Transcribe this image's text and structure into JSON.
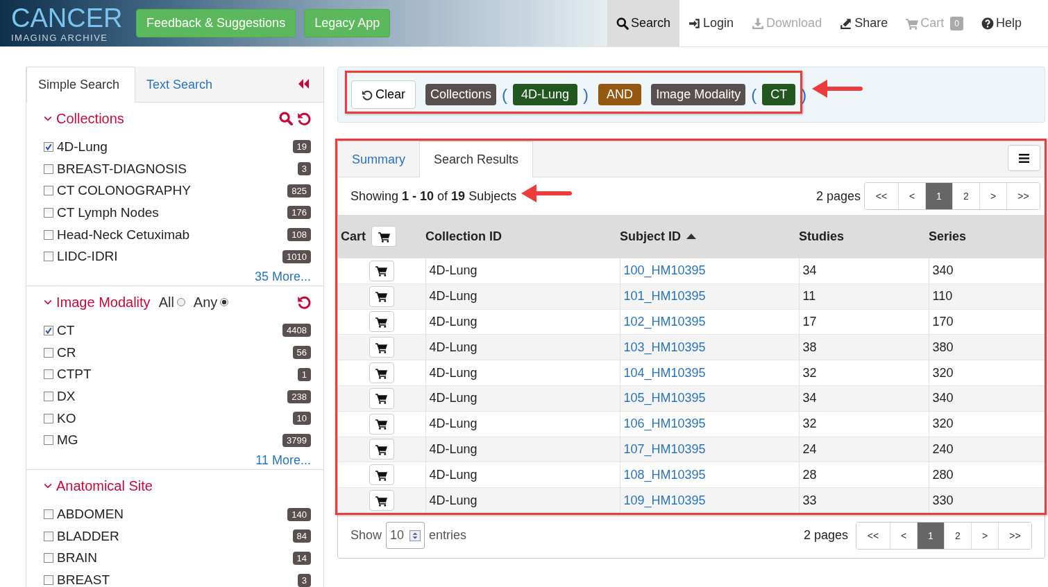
{
  "header": {
    "logo": {
      "line1": "CANCER",
      "line2": "IMAGING ARCHIVE"
    },
    "buttons": [
      "Feedback & Suggestions",
      "Legacy App"
    ],
    "nav": [
      {
        "kind": "search",
        "label": "Search",
        "selected": true,
        "disabled": false
      },
      {
        "kind": "login",
        "label": "Login",
        "selected": false,
        "disabled": false
      },
      {
        "kind": "download",
        "label": "Download",
        "selected": false,
        "disabled": true
      },
      {
        "kind": "share",
        "label": "Share",
        "selected": false,
        "disabled": false
      },
      {
        "kind": "cart",
        "label": "Cart",
        "selected": false,
        "disabled": true,
        "badge": "0"
      },
      {
        "kind": "help",
        "label": "Help",
        "selected": false,
        "disabled": false
      }
    ]
  },
  "sidebar": {
    "tabs": [
      {
        "label": "Simple Search",
        "selected": true
      },
      {
        "label": "Text Search",
        "selected": false
      }
    ],
    "sections": [
      {
        "title": "Collections",
        "expanded": true,
        "searchable": true,
        "resettable": true,
        "more": "35 More...",
        "items": [
          {
            "label": "4D-Lung",
            "count": "19",
            "checked": true
          },
          {
            "label": "BREAST-DIAGNOSIS",
            "count": "3",
            "checked": false
          },
          {
            "label": "CT COLONOGRAPHY",
            "count": "825",
            "checked": false
          },
          {
            "label": "CT Lymph Nodes",
            "count": "176",
            "checked": false
          },
          {
            "label": "Head-Neck Cetuximab",
            "count": "108",
            "checked": false
          },
          {
            "label": "LIDC-IDRI",
            "count": "1010",
            "checked": false
          }
        ]
      },
      {
        "title": "Image Modality",
        "expanded": true,
        "searchable": false,
        "resettable": true,
        "match": [
          {
            "label": "All",
            "selected": false
          },
          {
            "label": "Any",
            "selected": true
          }
        ],
        "more": "11 More...",
        "items": [
          {
            "label": "CT",
            "count": "4408",
            "checked": true
          },
          {
            "label": "CR",
            "count": "56",
            "checked": false
          },
          {
            "label": "CTPT",
            "count": "1",
            "checked": false
          },
          {
            "label": "DX",
            "count": "238",
            "checked": false
          },
          {
            "label": "KO",
            "count": "10",
            "checked": false
          },
          {
            "label": "MG",
            "count": "3799",
            "checked": false
          }
        ]
      },
      {
        "title": "Anatomical Site",
        "expanded": true,
        "searchable": false,
        "resettable": false,
        "items": [
          {
            "label": "ABDOMEN",
            "count": "140",
            "checked": false
          },
          {
            "label": "BLADDER",
            "count": "84",
            "checked": false
          },
          {
            "label": "BRAIN",
            "count": "14",
            "checked": false
          },
          {
            "label": "BREAST",
            "count": "3",
            "checked": false
          }
        ]
      }
    ]
  },
  "filter_bar": {
    "clear": "Clear",
    "tokens": [
      {
        "kind": "category",
        "text": "Collections"
      },
      {
        "kind": "paren",
        "text": "("
      },
      {
        "kind": "value",
        "text": "4D-Lung"
      },
      {
        "kind": "paren",
        "text": ")"
      },
      {
        "kind": "operator",
        "text": "AND"
      },
      {
        "kind": "category",
        "text": "Image Modality"
      },
      {
        "kind": "paren",
        "text": "("
      },
      {
        "kind": "value",
        "text": "CT"
      },
      {
        "kind": "paren",
        "text": ")"
      }
    ]
  },
  "results": {
    "tabs": [
      {
        "label": "Summary",
        "selected": false
      },
      {
        "label": "Search Results",
        "selected": true
      }
    ],
    "showing": "Showing **1 - 10** of **19** Subjects",
    "pages": "2 pages",
    "pagination": [
      {
        "label": "<<",
        "selected": false
      },
      {
        "label": "<",
        "selected": false
      },
      {
        "label": "1",
        "selected": true
      },
      {
        "label": "2",
        "selected": false
      },
      {
        "label": ">",
        "selected": false
      },
      {
        "label": ">>",
        "selected": false
      }
    ],
    "columns": [
      {
        "label": "Cart",
        "sorted_ascending": false
      },
      {
        "label": "Collection ID",
        "sorted_ascending": false
      },
      {
        "label": "Subject ID",
        "sorted_ascending": true
      },
      {
        "label": "Studies",
        "sorted_ascending": false
      },
      {
        "label": "Series",
        "sorted_ascending": false
      }
    ],
    "rows": [
      {
        "collection": "4D-Lung",
        "subject": "100_HM10395",
        "studies": "34",
        "series": "340"
      },
      {
        "collection": "4D-Lung",
        "subject": "101_HM10395",
        "studies": "11",
        "series": "110"
      },
      {
        "collection": "4D-Lung",
        "subject": "102_HM10395",
        "studies": "17",
        "series": "170"
      },
      {
        "collection": "4D-Lung",
        "subject": "103_HM10395",
        "studies": "38",
        "series": "380"
      },
      {
        "collection": "4D-Lung",
        "subject": "104_HM10395",
        "studies": "32",
        "series": "320"
      },
      {
        "collection": "4D-Lung",
        "subject": "105_HM10395",
        "studies": "34",
        "series": "340"
      },
      {
        "collection": "4D-Lung",
        "subject": "106_HM10395",
        "studies": "32",
        "series": "320"
      },
      {
        "collection": "4D-Lung",
        "subject": "107_HM10395",
        "studies": "24",
        "series": "240"
      },
      {
        "collection": "4D-Lung",
        "subject": "108_HM10395",
        "studies": "28",
        "series": "280"
      },
      {
        "collection": "4D-Lung",
        "subject": "109_HM10395",
        "studies": "33",
        "series": "330"
      }
    ],
    "footer": {
      "show": "Show",
      "page_size": "10",
      "entries": "entries",
      "pages": "2 pages",
      "pagination": [
        {
          "label": "<<",
          "selected": false
        },
        {
          "label": "<",
          "selected": false
        },
        {
          "label": "1",
          "selected": true
        },
        {
          "label": "2",
          "selected": false
        },
        {
          "label": ">",
          "selected": false
        },
        {
          "label": ">>",
          "selected": false
        }
      ]
    }
  }
}
